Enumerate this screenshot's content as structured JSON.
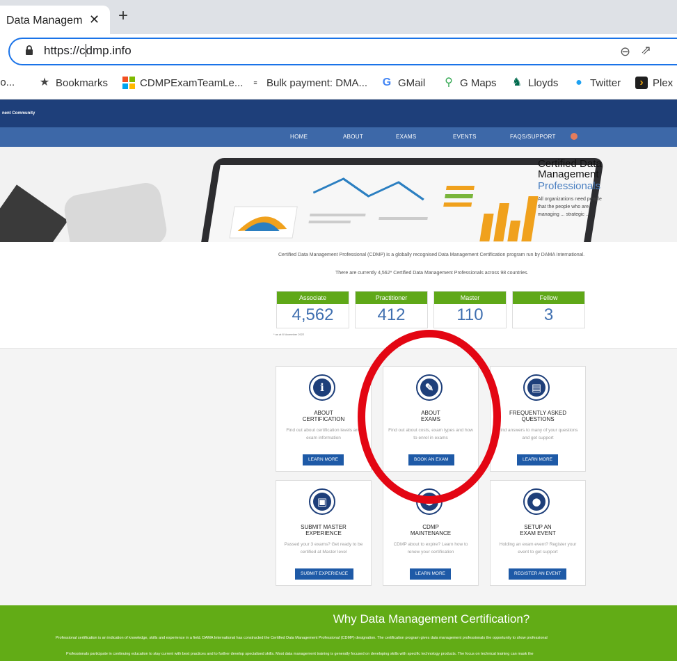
{
  "browser": {
    "tab_title": "Data Managem",
    "url_prefix": "https://c",
    "url_rest": "dmp.info",
    "bookmarks": [
      {
        "label": "lo...",
        "icon": ""
      },
      {
        "label": "Bookmarks",
        "icon": "star-icon"
      },
      {
        "label": "CDMPExamTeamLe...",
        "icon": "microsoft-icon"
      },
      {
        "label": "Bulk payment: DMA...",
        "icon": "cdmp-icon"
      },
      {
        "label": "GMail",
        "icon": "google-icon"
      },
      {
        "label": "G Maps",
        "icon": "maps-pin-icon"
      },
      {
        "label": "Lloyds",
        "icon": "horse-icon"
      },
      {
        "label": "Twitter",
        "icon": "twitter-icon"
      },
      {
        "label": "Plex",
        "icon": "plex-icon"
      }
    ]
  },
  "site": {
    "brand": "nent Community",
    "nav": [
      "HOME",
      "ABOUT",
      "EXAMS",
      "EVENTS",
      "FAQS/SUPPORT"
    ],
    "hero": {
      "title": "Certified Data Management",
      "subtitle": "Professionals",
      "body": "All organizations need people that the people who are managing ... strategic ..."
    },
    "intro1": "Certified Data Management Professional (CDMP) is a globally recognised Data Management Certification program run by DAMA International.",
    "intro2": "There are currently 4,562* Certified Data Management Professionals across 98 countries.",
    "stats": [
      {
        "label": "Associate",
        "value": "4,562"
      },
      {
        "label": "Practitioner",
        "value": "412"
      },
      {
        "label": "Master",
        "value": "110"
      },
      {
        "label": "Fellow",
        "value": "3"
      }
    ],
    "stat_note": "* as at 8 November 2022",
    "cards": [
      {
        "title": "ABOUT\nCERTIFICATION",
        "desc": "Find out about certification levels and exam information",
        "button": "LEARN MORE",
        "icon": "info-icon",
        "glyph": "i"
      },
      {
        "title": "ABOUT\nEXAMS",
        "desc": "Find out about costs, exam types and how to enrol in exams",
        "button": "BOOK AN EXAM",
        "icon": "pencil-icon",
        "glyph": "✎"
      },
      {
        "title": "FREQUENTLY ASKED\nQUESTIONS",
        "desc": "Find answers to many of your questions and get support",
        "button": "LEARN MORE",
        "icon": "book-icon",
        "glyph": "▤"
      },
      {
        "title": "SUBMIT MASTER\nEXPERIENCE",
        "desc": "Passed your 3 exams? Get ready to be certified at Master level",
        "button": "SUBMIT EXPERIENCE",
        "icon": "briefcase-icon",
        "glyph": "▣"
      },
      {
        "title": "CDMP\nMAINTENANCE",
        "desc": "CDMP about to expire? Learn how to renew your certification",
        "button": "LEARN MORE",
        "icon": "award-icon",
        "glyph": "✪"
      },
      {
        "title": "SETUP AN\nEXAM EVENT",
        "desc": "Holding an exam event? Register your event to get support",
        "button": "REGISTER AN EVENT",
        "icon": "location-pin-icon",
        "glyph": "●"
      }
    ],
    "why_title": "Why Data Management Certification?",
    "why_p1": "Professional certification is an indication of knowledge, skills and experience in a field. DAMA International has constructed the Certified Data Management Professional (CDMP) designation. The certification program gives data management professionals the opportunity to show professional",
    "why_p2": "Professionals participate in continuing education to stay current with best practices and to further develop specialised skills. Most data management training is generally focused on developing skills with specific technology products. The focus on technical training can mask the"
  },
  "colors": {
    "navy": "#1e3f7a",
    "nav_blue": "#3d68a8",
    "green": "#62ac16",
    "stat_green": "#5fa818",
    "button_blue": "#1e5aa7",
    "annotation_red": "#e30613"
  }
}
